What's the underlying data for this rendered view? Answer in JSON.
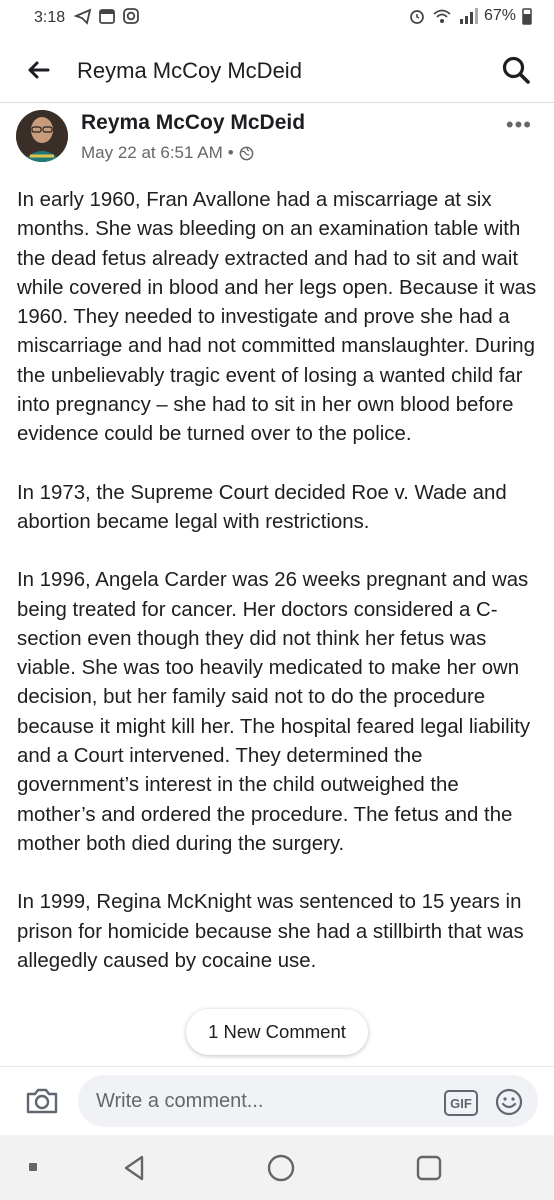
{
  "status_bar": {
    "time": "3:18",
    "battery": "67%"
  },
  "header": {
    "title": "Reyma McCoy McDeid"
  },
  "post": {
    "author": "Reyma McCoy McDeid",
    "timestamp": "May 22 at 6:51 AM",
    "separator": "•",
    "privacy_icon": "globe-icon",
    "paragraphs": [
      "In early 1960, Fran Avallone had a miscarriage at six months. She was bleeding on an examination table with the dead fetus already extracted and had to sit and wait while covered in blood and her legs open. Because it was 1960. They needed to investigate and prove she had a miscarriage and had not committed manslaughter.  During the unbelievably tragic event of losing a wanted child far into pregnancy – she had to sit in her own blood before evidence could be turned over to the police.",
      "In 1973, the Supreme Court decided Roe v. Wade and abortion became legal with restrictions.",
      "In 1996, Angela Carder was 26 weeks pregnant and was being treated for cancer. Her doctors considered a C-section even though they did not think her fetus was viable. She was too heavily medicated to make her own decision, but her family said not to do the procedure because it might kill her. The hospital feared legal liability and a Court intervened. They determined the government’s interest in the child outweighed the mother’s and ordered the procedure. The fetus and the mother both died during the surgery.",
      "In 1999, Regina McKnight was sentenced to 15 years in prison for homicide because she had a stillbirth that was allegedly caused by cocaine use."
    ]
  },
  "new_comment_pill": "1 New Comment",
  "comment_bar": {
    "placeholder": "Write a comment...",
    "gif_label": "GIF"
  },
  "colors": {
    "text": "#1c1e21",
    "secondary": "#65676b",
    "input_bg": "#f0f2f5"
  }
}
